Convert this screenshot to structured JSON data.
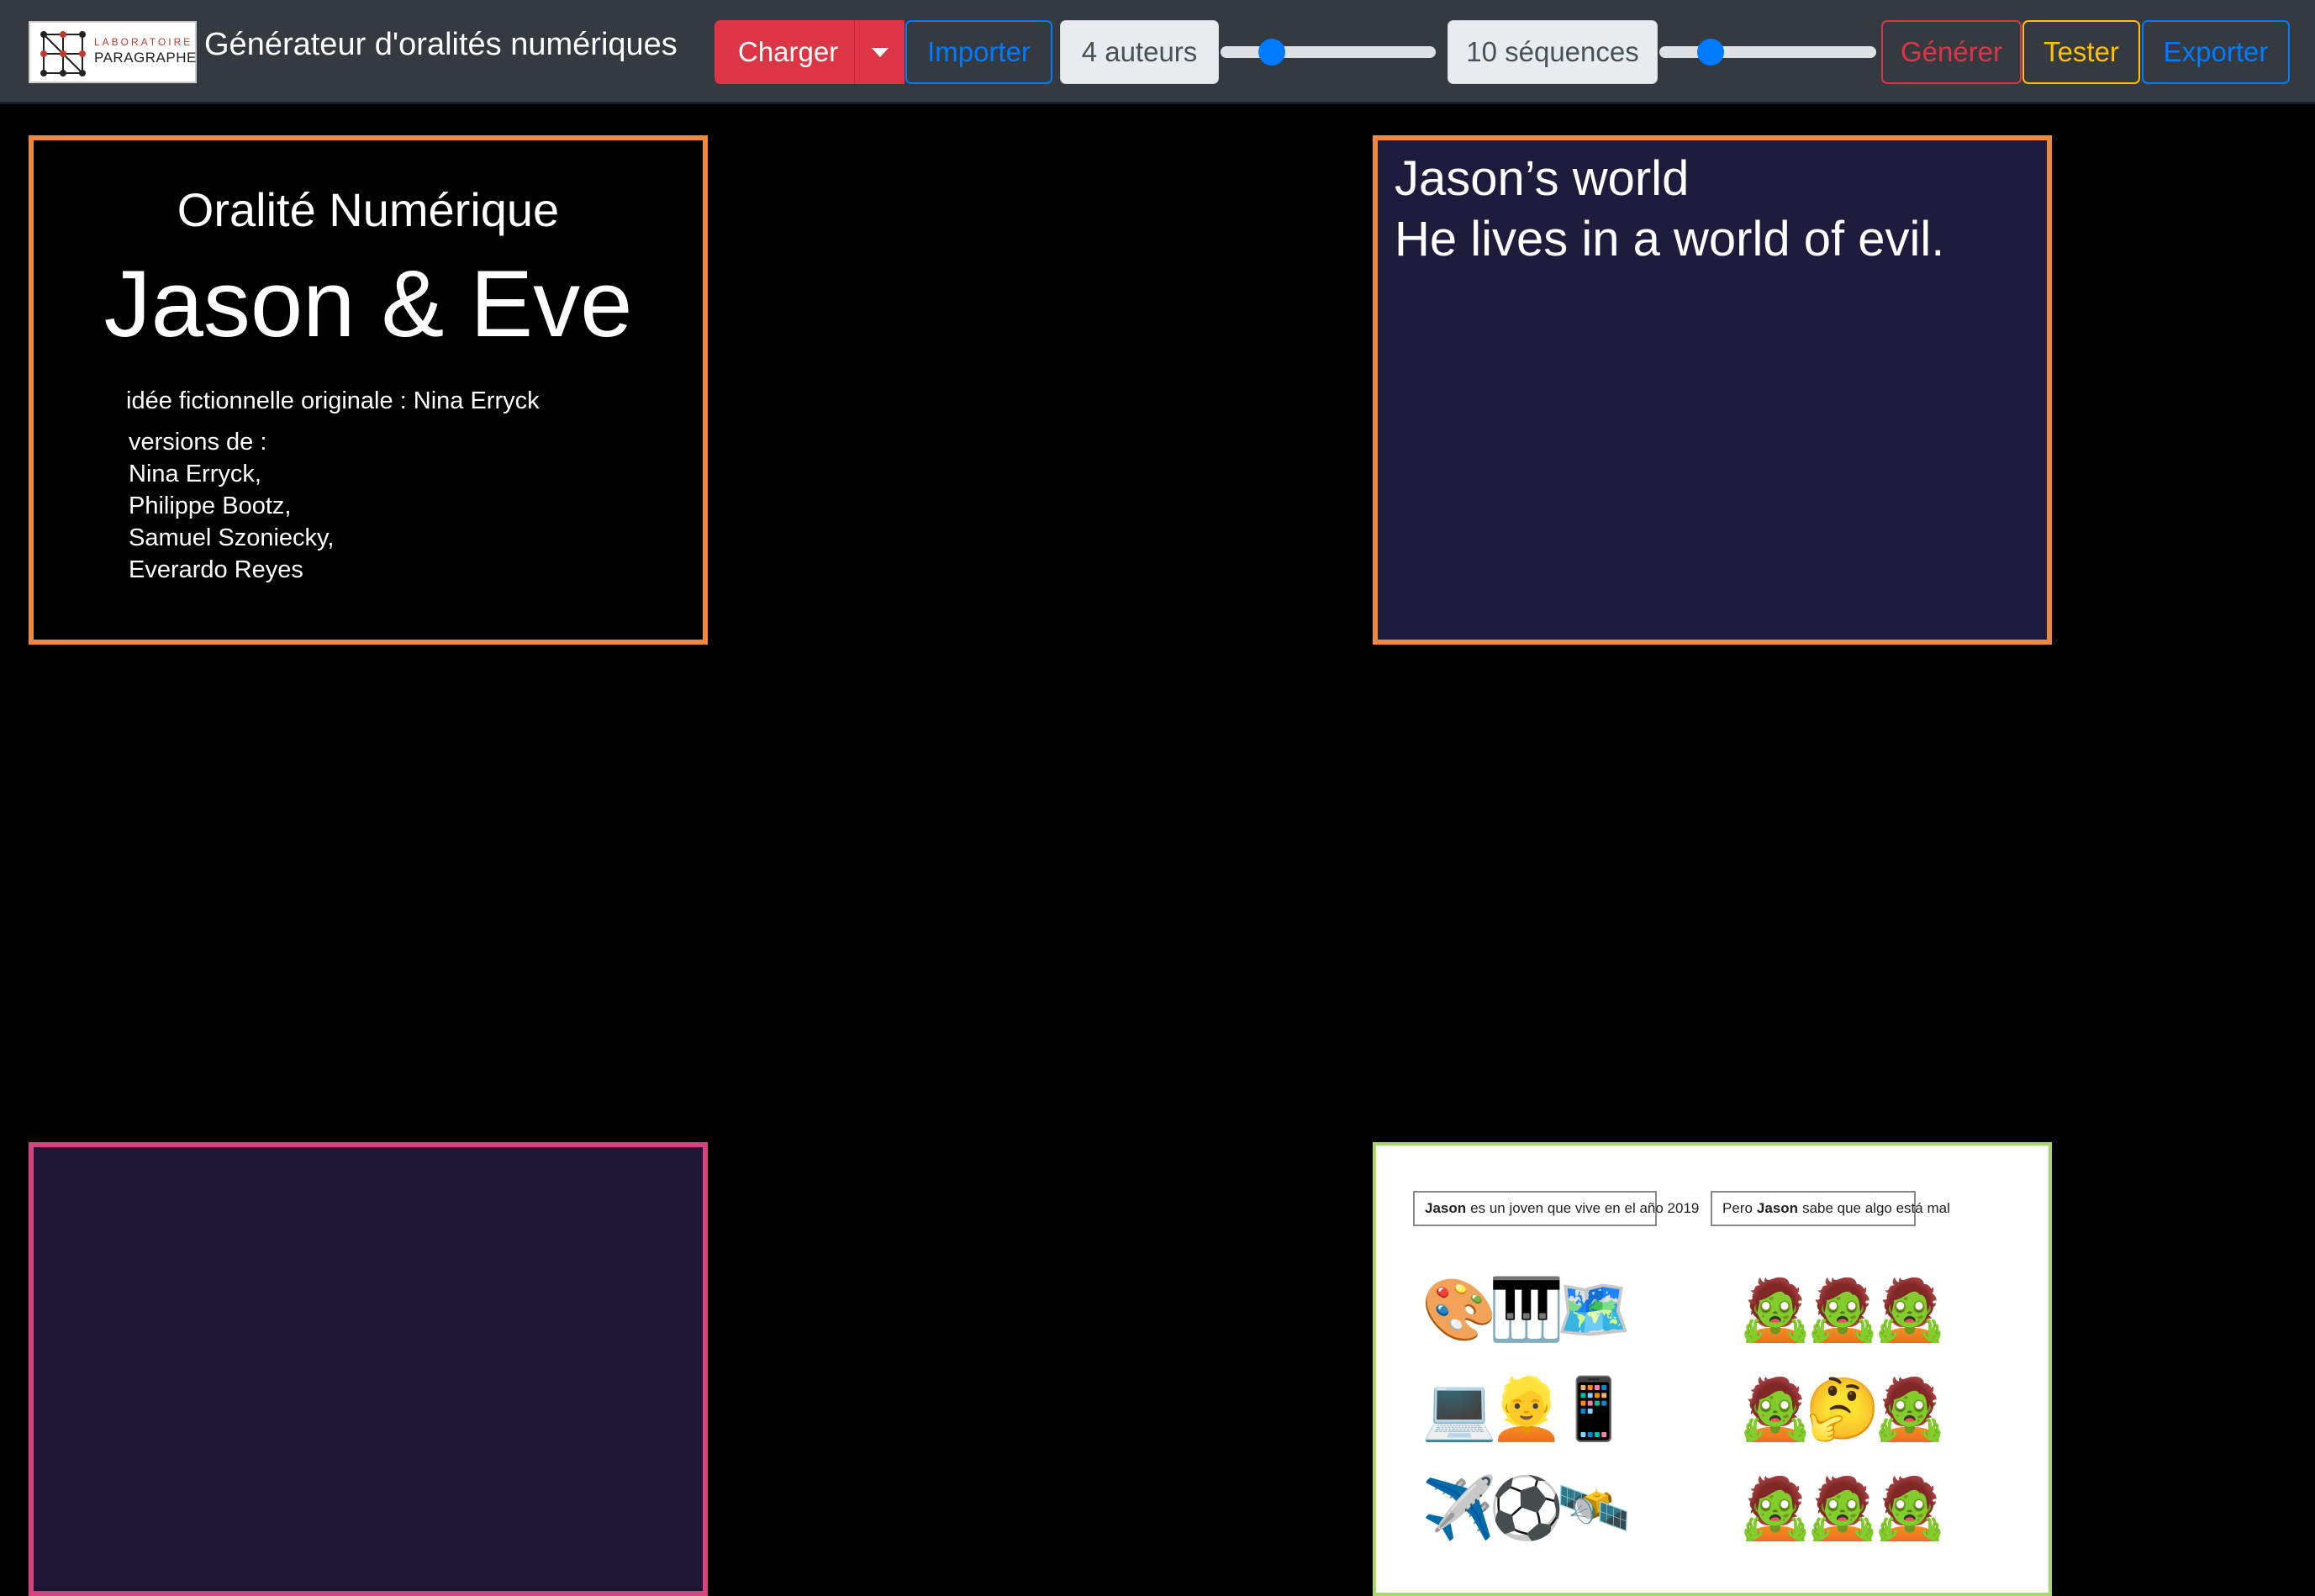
{
  "app": {
    "logo_line1": "LABORATOIRE",
    "logo_line2": "PARAGRAPHE",
    "title": "Générateur d'oralités numériques"
  },
  "toolbar": {
    "charger": "Charger",
    "importer": "Importer",
    "auteurs": "4 auteurs",
    "auteurs_slider_value": 0.2,
    "sequences": "10 séquences",
    "sequences_slider_value": 0.2,
    "generer": "Générer",
    "tester": "Tester",
    "exporter": "Exporter"
  },
  "panels": {
    "title_card": {
      "subtitle": "Oralité Numérique",
      "title": "Jason & Eve",
      "idea": "idée fictionnelle originale : Nina Erryck",
      "versions_label": "versions de :",
      "authors": [
        "Nina Erryck,",
        "Philippe Bootz,",
        "Samuel Szoniecky,",
        "Everardo Reyes"
      ]
    },
    "world_card": {
      "title": "Jason’s world",
      "text": "He lives in a world of evil."
    },
    "image_card": {
      "caption_left_bold": "Jason",
      "caption_left": "es un joven que vive en el año 2019",
      "caption_right_pre": "Pero",
      "caption_right_bold": "Jason",
      "caption_right": "sabe que algo está mal",
      "grid_left": [
        "🎨",
        "🎹",
        "🗺️",
        "💻",
        "👱",
        "📱",
        "✈️",
        "⚽",
        "🛰️"
      ],
      "grid_right": [
        "🧟",
        "🧟",
        "🧟",
        "🧟",
        "🤔",
        "🧟",
        "🧟",
        "🧟",
        "🧟"
      ]
    }
  },
  "colors": {
    "navbar": "#343a40",
    "danger": "#dc3545",
    "primary": "#007bff",
    "warning": "#ffc107",
    "panel_orange": "#f0883e",
    "panel_pink": "#d6447f",
    "panel_green": "#a6d96a"
  }
}
